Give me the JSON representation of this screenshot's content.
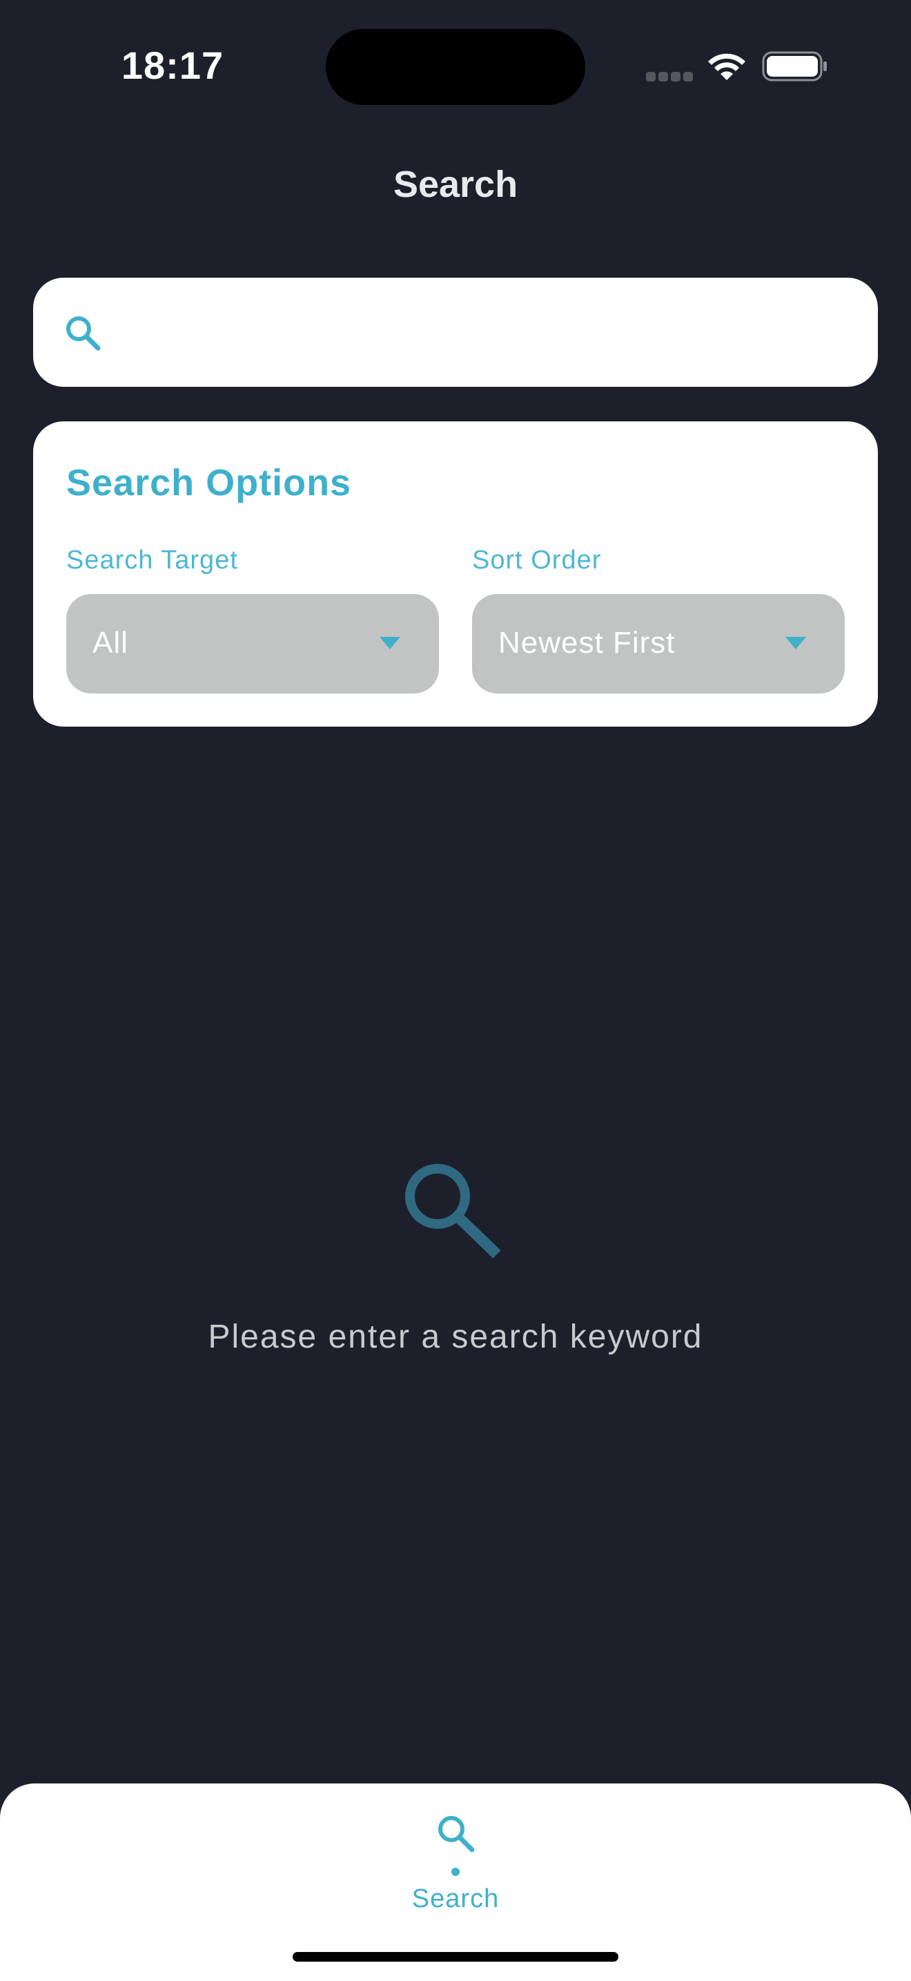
{
  "status_bar": {
    "time": "18:17",
    "icons": [
      "cellular-signal-icon",
      "wifi-icon",
      "battery-icon"
    ]
  },
  "header": {
    "title": "Search"
  },
  "search": {
    "icon": "search-icon",
    "value": "",
    "placeholder": ""
  },
  "search_options": {
    "title": "Search Options",
    "target": {
      "label": "Search Target",
      "selected": "All",
      "icon": "caret-down-icon"
    },
    "sort": {
      "label": "Sort Order",
      "selected": "Newest First",
      "icon": "caret-down-icon"
    }
  },
  "empty_state": {
    "icon": "search-icon",
    "message": "Please enter a search keyword"
  },
  "bottom_nav": {
    "items": [
      {
        "label": "Search",
        "icon": "search-icon",
        "active": true
      }
    ]
  },
  "colors": {
    "background": "#1d202b",
    "accent": "#3fb0cc",
    "card": "#ffffff",
    "dropdown": "#c2c4c4",
    "empty_icon": "#2f6a82"
  }
}
